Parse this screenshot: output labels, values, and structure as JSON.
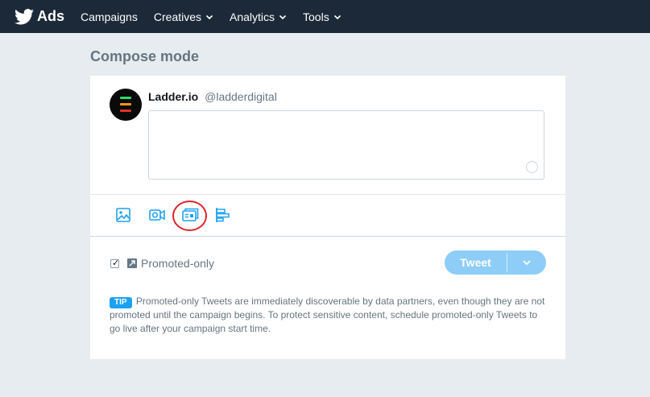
{
  "topbar": {
    "brand": "Ads",
    "nav": [
      {
        "label": "Campaigns",
        "dropdown": false
      },
      {
        "label": "Creatives",
        "dropdown": true
      },
      {
        "label": "Analytics",
        "dropdown": true
      },
      {
        "label": "Tools",
        "dropdown": true
      }
    ]
  },
  "page": {
    "title": "Compose mode"
  },
  "account": {
    "name": "Ladder.io",
    "handle": "@ladderdigital"
  },
  "compose": {
    "value": ""
  },
  "media_icons": [
    "image-icon",
    "video-icon",
    "card-icon",
    "poll-icon"
  ],
  "promo": {
    "checked": true,
    "label": "Promoted-only"
  },
  "tweet_button": {
    "label": "Tweet"
  },
  "tip": {
    "badge": "TIP",
    "text": "Promoted-only Tweets are immediately discoverable by data partners, even though they are not promoted until the campaign begins. To protect sensitive content, schedule promoted-only Tweets to go live after your campaign start time."
  },
  "colors": {
    "topbar": "#1c2938",
    "background": "#e6ecf0",
    "accent": "#1da1f2",
    "tweet_button": "#8ecdf8",
    "highlight": "#e0202a"
  }
}
